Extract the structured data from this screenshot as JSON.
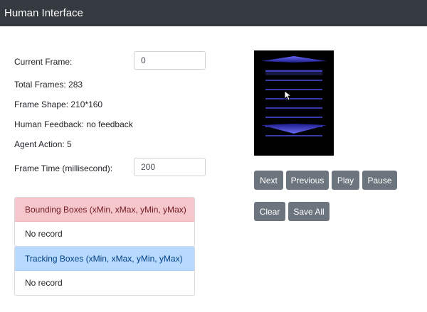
{
  "navbar": {
    "title": "Human Interface"
  },
  "info": {
    "current_frame_label": "Current Frame:",
    "current_frame_value": "0",
    "total_frames": "Total Frames: 283",
    "frame_shape": "Frame Shape: 210*160",
    "human_feedback": "Human Feedback: no feedback",
    "agent_action": "Agent Action: 5",
    "frame_time_label": "Frame Time (millisecond):",
    "frame_time_value": "200"
  },
  "bounding_boxes": {
    "title": "Bounding Boxes (xMin, xMax, yMin, yMax)",
    "body": "No record"
  },
  "tracking_boxes": {
    "title": "Tracking Boxes (xMin, xMax, yMin, yMax)",
    "body": "No record"
  },
  "controls": {
    "next": "Next",
    "previous": "Previous",
    "play": "Play",
    "pause": "Pause",
    "clear": "Clear",
    "save_all": "Save All"
  },
  "colors": {
    "navbar": "#343a40",
    "button": "#6c757d",
    "danger_header": "#f5c6cb",
    "primary_header": "#b8daff",
    "game_lines": "#4a4ae0"
  }
}
